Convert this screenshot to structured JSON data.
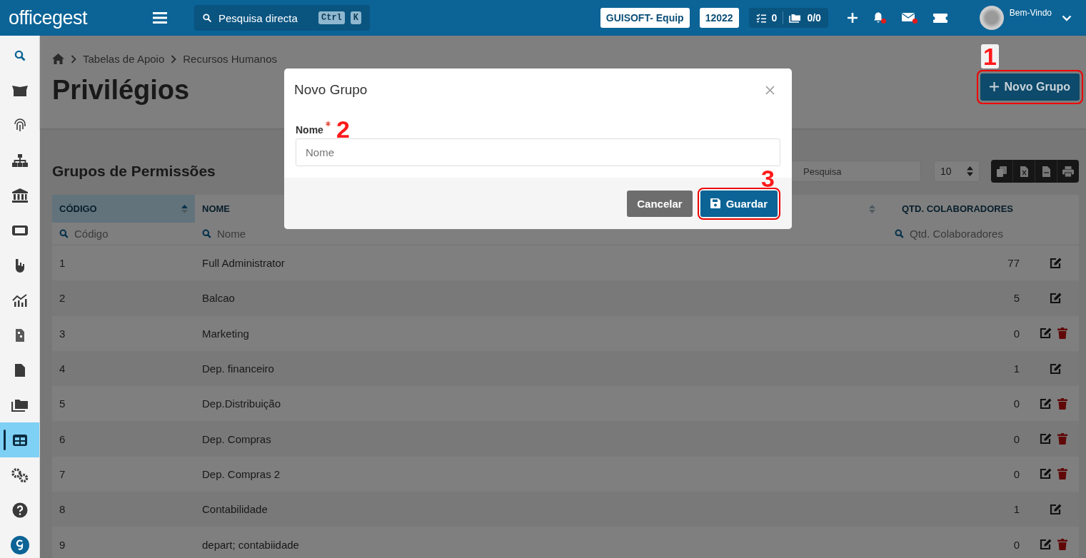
{
  "topbar": {
    "logo": "officegest",
    "search": {
      "placeholder": "Pesquisa directa",
      "keys": [
        "Ctrl",
        "K"
      ]
    },
    "company": "GUISOFT- Equip",
    "year": "12022",
    "tasks": "0",
    "folders": "0/0",
    "notifications_unread": true,
    "messages_unread": true,
    "greeting": "Bem-Vindo"
  },
  "sidebar": {
    "items": [
      {
        "selected": false
      },
      {
        "selected": false
      },
      {
        "selected": false
      },
      {
        "selected": false
      },
      {
        "selected": false
      },
      {
        "selected": false
      },
      {
        "selected": false
      },
      {
        "selected": false
      },
      {
        "selected": false
      },
      {
        "selected": false
      },
      {
        "selected": false
      },
      {
        "selected": true
      },
      {
        "selected": false
      },
      {
        "selected": false
      },
      {
        "selected": false
      }
    ]
  },
  "breadcrumb": [
    "Tabelas de Apoio",
    "Recursos Humanos"
  ],
  "title": "Privilégios",
  "new_button": {
    "label": "Novo Grupo",
    "annotation": "1"
  },
  "section_title": "Grupos de Permissões",
  "table_search": {
    "placeholder": "Pesquisa"
  },
  "page_size": "10",
  "table": {
    "columns": [
      {
        "label": "CÓDIGO",
        "placeholder": "Código",
        "sorted": true
      },
      {
        "label": "NOME",
        "placeholder": "Nome",
        "sorted": false
      },
      {
        "label": "QTD. COLABORADORES",
        "placeholder": "Qtd. Colaboradores",
        "sorted": false
      }
    ],
    "rows": [
      {
        "code": "1",
        "name": "Full Administrator",
        "count": "77",
        "deletable": false
      },
      {
        "code": "2",
        "name": "Balcao",
        "count": "5",
        "deletable": false
      },
      {
        "code": "3",
        "name": "Marketing",
        "count": "0",
        "deletable": true
      },
      {
        "code": "4",
        "name": "Dep. financeiro",
        "count": "1",
        "deletable": false
      },
      {
        "code": "5",
        "name": "Dep.Distribuição",
        "count": "0",
        "deletable": true
      },
      {
        "code": "6",
        "name": "Dep. Compras",
        "count": "0",
        "deletable": true
      },
      {
        "code": "7",
        "name": "Dep. Compras 2",
        "count": "0",
        "deletable": true
      },
      {
        "code": "8",
        "name": "Contabilidade",
        "count": "1",
        "deletable": false
      },
      {
        "code": "9",
        "name": "depart; contabiidade",
        "count": "0",
        "deletable": true
      }
    ]
  },
  "modal": {
    "title": "Novo Grupo",
    "field": {
      "label": "Nome",
      "required": true,
      "placeholder": "Nome",
      "annotation": "2"
    },
    "buttons": [
      {
        "label": "Cancelar",
        "kind": "secondary"
      },
      {
        "label": "Guardar",
        "kind": "primary",
        "annotation": "3"
      }
    ]
  }
}
